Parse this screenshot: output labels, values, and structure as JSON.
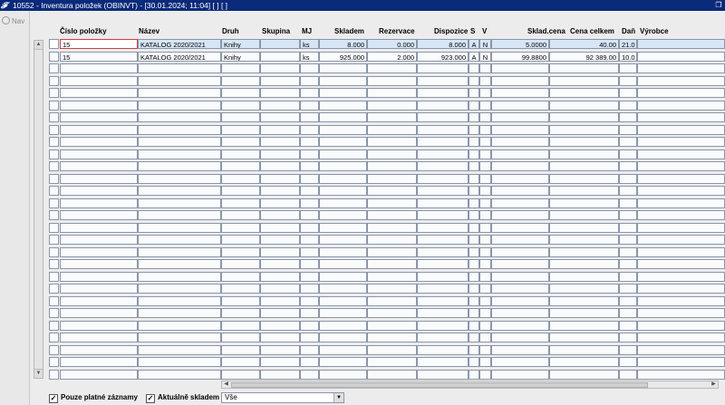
{
  "window": {
    "title": "10552 - Inventura položek (OBINVT) - [30.01.2024; 11:04]  [ ]  [ ]",
    "logo": "𝓕"
  },
  "nav": {
    "label": "Nav"
  },
  "columns": {
    "cislo": "Číslo položky",
    "nazev": "Název",
    "druh": "Druh",
    "skupina": "Skupina",
    "mj": "MJ",
    "skladem": "Skladem",
    "rezervace": "Rezervace",
    "dispozice": "Dispozice",
    "s": "S",
    "v": "V",
    "sklad_cena": "Sklad.cena",
    "cena_celkem": "Cena celkem",
    "dan": "Daň",
    "vyrobce": "Výrobce"
  },
  "rows": [
    {
      "cislo": "15",
      "nazev": "KATALOG 2020/2021",
      "druh": "Knihy",
      "skupina": "",
      "mj": "ks",
      "skladem": "8.000",
      "rezervace": "0.000",
      "dispozice": "8.000",
      "s": "A",
      "v": "N",
      "sklad_cena": "5.0000",
      "cena_celkem": "40.00",
      "dan": "21.0",
      "vyrobce": ""
    },
    {
      "cislo": "15",
      "nazev": "KATALOG 2020/2021",
      "druh": "Knihy",
      "skupina": "",
      "mj": "ks",
      "skladem": "925.000",
      "rezervace": "2.000",
      "dispozice": "923.000",
      "s": "A",
      "v": "N",
      "sklad_cena": "99.8800",
      "cena_celkem": "92 389.00",
      "dan": "10.0",
      "vyrobce": ""
    }
  ],
  "filters": {
    "only_valid": "Pouze platné záznamy",
    "current_stock": "Aktuálně skladem",
    "select_value": "Vše"
  }
}
